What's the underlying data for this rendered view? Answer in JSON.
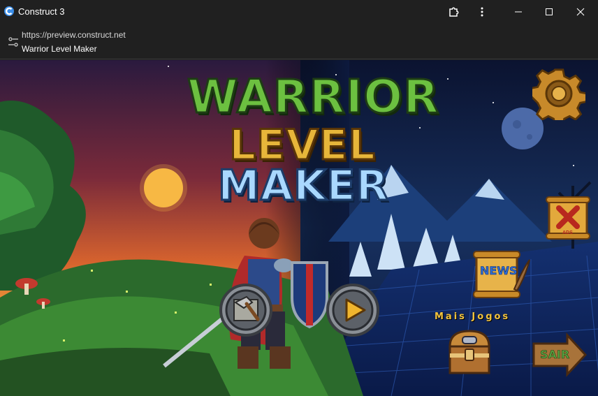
{
  "window": {
    "title": "Construct 3",
    "icon": "construct-logo-icon"
  },
  "address": {
    "url": "https://preview.construct.net",
    "page_title": "Warrior Level Maker"
  },
  "game": {
    "logo_lines": [
      "WARRIOR",
      "LEVEL",
      "MAKER"
    ],
    "more_games_label": "Mais Jogos",
    "news_label": "NEWS",
    "ads_label": "ADS",
    "exit_label": "SAIR"
  },
  "colors": {
    "titlebar_bg": "#202020",
    "logo_green": "#6cc040",
    "logo_gold": "#e7b63a",
    "logo_ice": "#a9d8ff",
    "accent_gold": "#f2c33d"
  }
}
